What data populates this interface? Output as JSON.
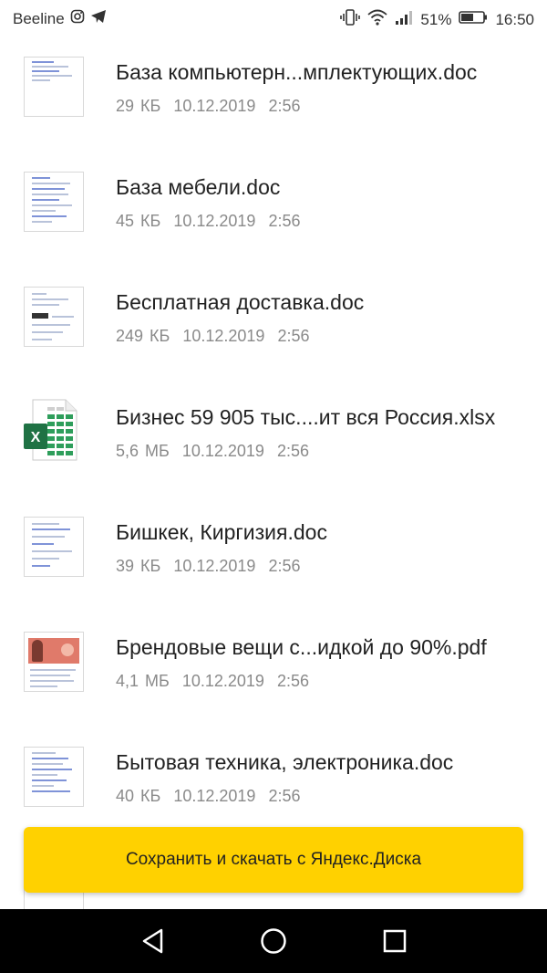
{
  "status_bar": {
    "carrier": "Beeline",
    "battery": "51%",
    "time": "16:50",
    "icons": [
      "instagram-icon",
      "telegram-icon",
      "vibrate-icon",
      "wifi-icon",
      "signal-icon",
      "battery-icon"
    ]
  },
  "files": [
    {
      "name": "База компьютерн...мплектующих.doc",
      "size": "29 КБ",
      "date": "10.12.2019",
      "time": "2:56",
      "type": "doc"
    },
    {
      "name": "База мебели.doc",
      "size": "45 КБ",
      "date": "10.12.2019",
      "time": "2:56",
      "type": "doc"
    },
    {
      "name": "Бесплатная доставка.doc",
      "size": "249 КБ",
      "date": "10.12.2019",
      "time": "2:56",
      "type": "doc"
    },
    {
      "name": "Бизнес 59 905 тыс....ит вся Россия.xlsx",
      "size": "5,6 МБ",
      "date": "10.12.2019",
      "time": "2:56",
      "type": "xlsx"
    },
    {
      "name": "Бишкек, Киргизия.doc",
      "size": "39 КБ",
      "date": "10.12.2019",
      "time": "2:56",
      "type": "doc"
    },
    {
      "name": "Брендовые вещи с...идкой до 90%.pdf",
      "size": "4,1 МБ",
      "date": "10.12.2019",
      "time": "2:56",
      "type": "pdf"
    },
    {
      "name": "Бытовая техника, электроника.doc",
      "size": "40 КБ",
      "date": "10.12.2019",
      "time": "2:56",
      "type": "doc"
    }
  ],
  "save_button": {
    "label": "Сохранить и скачать с Яндекс.Диска"
  },
  "colors": {
    "accent": "#ffd100",
    "excel_green": "#1f7244"
  },
  "nav": {
    "icons": [
      "back-icon",
      "home-icon",
      "recents-icon"
    ]
  }
}
